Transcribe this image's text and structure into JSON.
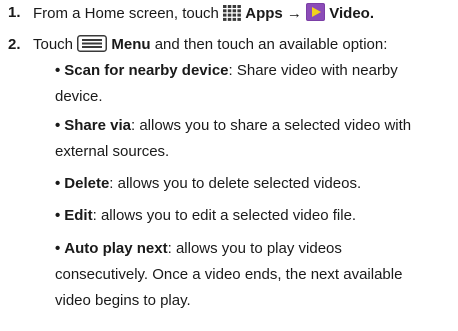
{
  "steps": [
    {
      "number": "1.",
      "pre": "From a Home screen, touch",
      "apps_icon": "apps-grid-icon",
      "apps_label": "Apps",
      "arrow": "→",
      "video_icon": "video-play-icon",
      "video_label": "Video",
      "end": "."
    },
    {
      "number": "2.",
      "pre": "Touch",
      "menu_icon": "menu-icon",
      "menu_label": "Menu",
      "post": "and then touch an available option:"
    }
  ],
  "options": [
    {
      "term": "Scan for nearby device",
      "desc_line1": ": Share video with nearby",
      "desc_line2": "device.",
      "desc_line3": ""
    },
    {
      "term": "Share via",
      "desc_line1": ": allows you to share a selected video with",
      "desc_line2": "external sources.",
      "desc_line3": ""
    },
    {
      "term": "Delete",
      "desc_line1": ": allows you to delete selected videos.",
      "desc_line2": "",
      "desc_line3": ""
    },
    {
      "term": "Edit",
      "desc_line1": ": allows you to edit a selected video file.",
      "desc_line2": "",
      "desc_line3": ""
    },
    {
      "term": "Auto play next",
      "desc_line1": ": allows you to play videos",
      "desc_line2": "consecutively. Once a video ends, the next available",
      "desc_line3": "video begins to play."
    }
  ],
  "colors": {
    "text": "#1a1a1a",
    "video_icon_bg": "#7b3fa6",
    "video_icon_arrow": "#f2d21c",
    "apps_icon": "#3a3a3a",
    "menu_icon": "#3a3a3a"
  }
}
